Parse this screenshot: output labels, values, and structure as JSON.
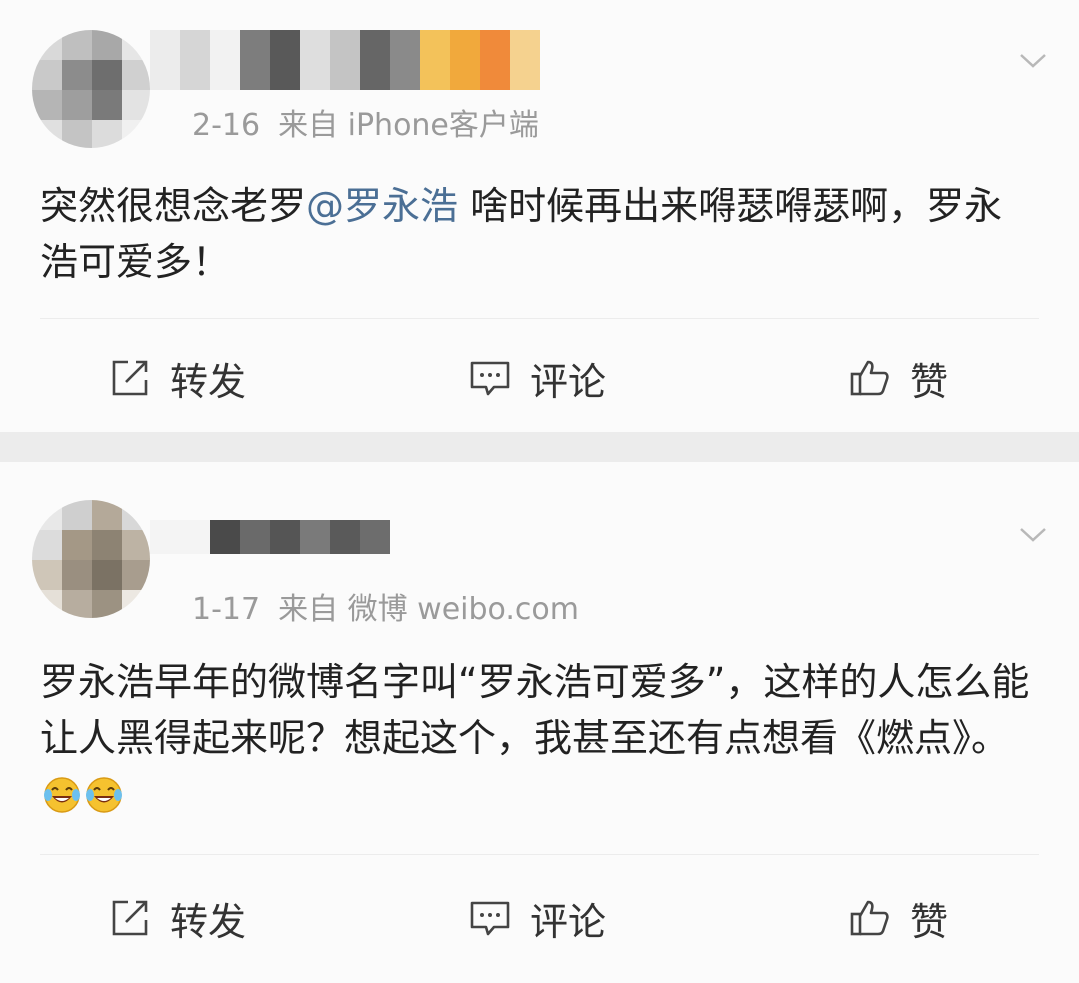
{
  "posts": [
    {
      "date": "2-16",
      "source": "来自 iPhone客户端",
      "content": {
        "before": "突然很想念老罗",
        "mention": "@罗永浩",
        "after": " 啥时候再出来嘚瑟嘚瑟啊，罗永浩可爱多！"
      },
      "actions": {
        "repost": "转发",
        "comment": "评论",
        "like": "赞"
      }
    },
    {
      "date": "1-17",
      "source": "来自 微博 weibo.com",
      "content": {
        "text": "罗永浩早年的微博名字叫“罗永浩可爱多”，这样的人怎么能让人黑得起来呢？想起这个，我甚至还有点想看《燃点》。"
      },
      "emoji_count": 2,
      "actions": {
        "repost": "转发",
        "comment": "评论",
        "like": "赞"
      }
    }
  ],
  "icons": {
    "more": "chevron-down-icon",
    "repost": "repost-icon",
    "comment": "comment-icon",
    "like": "thumbs-up-icon",
    "emoji": "laughing-tears-emoji-icon"
  },
  "colors": {
    "mention": "#4b6f95",
    "meta_text": "#9a9a9a",
    "separator": "#ececec"
  }
}
